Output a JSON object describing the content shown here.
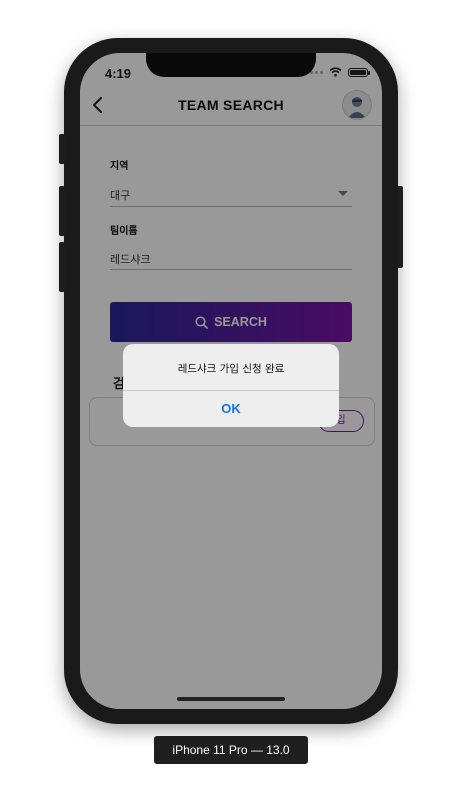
{
  "status_bar": {
    "time": "4:19"
  },
  "nav": {
    "title": "TEAM SEARCH"
  },
  "form": {
    "region_label": "지역",
    "region_value": "대구",
    "team_name_label": "팀이름",
    "team_name_value": "레드샤크"
  },
  "search_button": {
    "label": "SEARCH"
  },
  "results": {
    "heading": "검",
    "items": [
      {
        "team": "",
        "join_label": "입"
      }
    ]
  },
  "alert": {
    "message": "레드샤크 가입 신청 완료",
    "ok_label": "OK"
  },
  "device": {
    "label": "iPhone 11 Pro — 13.0"
  },
  "colors": {
    "accent_start": "#2a2a96",
    "accent_end": "#7a14a8",
    "alert_button": "#1a73e8",
    "overlay": "rgba(0,0,0,0.40)"
  },
  "icons": {
    "back": "chevron-left-icon",
    "search": "search-icon",
    "dropdown": "caret-down-icon",
    "wifi": "wifi-icon",
    "battery": "battery-icon",
    "avatar": "user-avatar-icon"
  }
}
